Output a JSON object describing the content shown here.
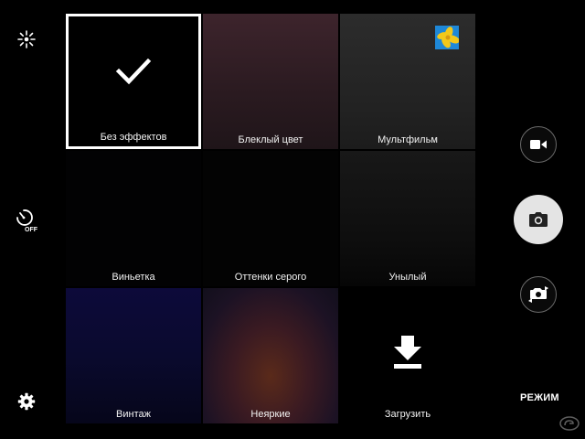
{
  "left_controls": [
    {
      "name": "effects-adjust",
      "icon": "sparkle-icon"
    },
    {
      "name": "timer-off",
      "icon": "timer-off-icon",
      "badge": "OFF"
    },
    {
      "name": "settings",
      "icon": "gear-icon"
    }
  ],
  "filters": [
    {
      "label": "Без эффектов",
      "selected": true
    },
    {
      "label": "Блеклый цвет",
      "selected": false
    },
    {
      "label": "Мультфильм",
      "selected": false
    },
    {
      "label": "Виньетка",
      "selected": false
    },
    {
      "label": "Оттенки серого",
      "selected": false
    },
    {
      "label": "Унылый",
      "selected": false
    },
    {
      "label": "Винтаж",
      "selected": false
    },
    {
      "label": "Неяркие",
      "selected": false
    },
    {
      "label": "Загрузить",
      "selected": false,
      "icon": "download-icon"
    }
  ],
  "right_controls": {
    "gallery_thumb_icon": "flower-thumbnail",
    "video_button_icon": "video-camera-icon",
    "shutter_icon": "camera-icon",
    "switch_camera_icon": "switch-camera-icon",
    "mode_label": "РЕЖИМ"
  },
  "colors": {
    "background": "#000000",
    "selected_border": "#ffffff",
    "shutter": "#e4e4e4",
    "thumb_blue": "#1e88d8",
    "thumb_yellow": "#f2c81a"
  }
}
